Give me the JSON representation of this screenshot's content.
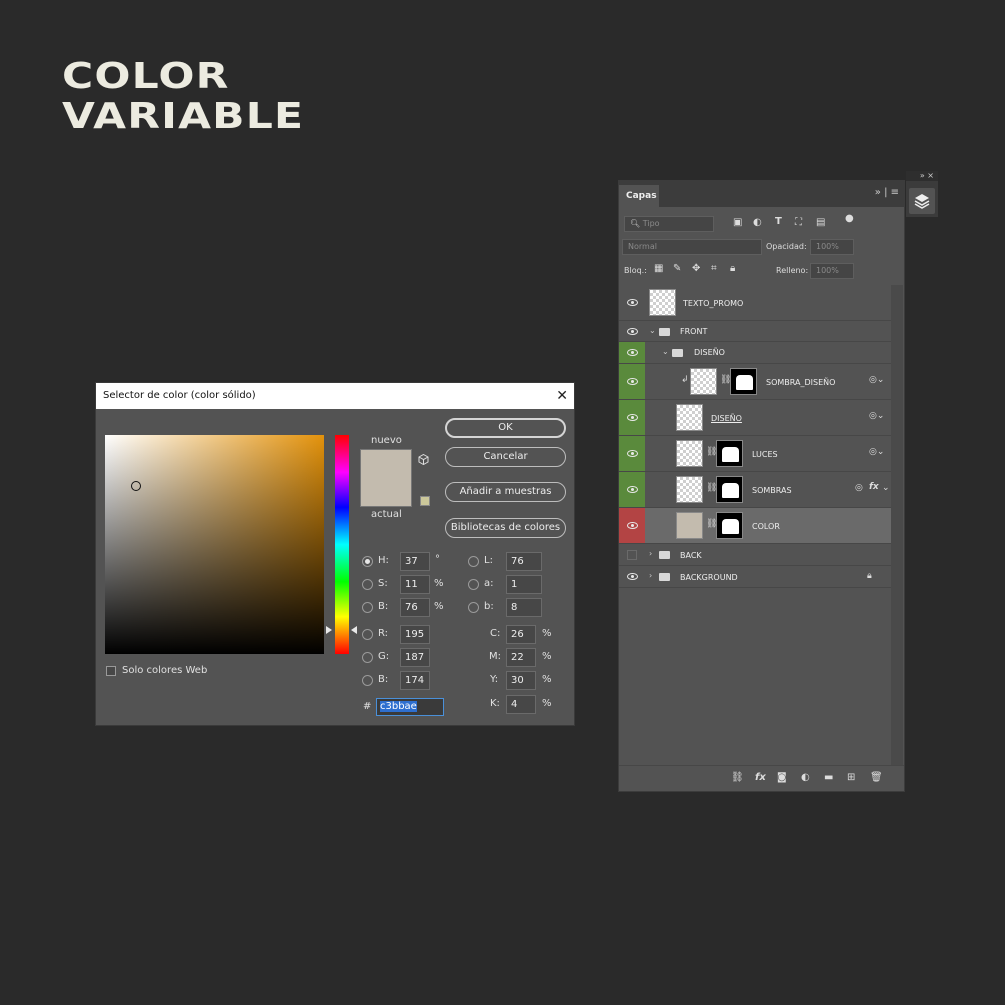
{
  "headline": {
    "line1": "COLOR",
    "line2": "VARIABLE"
  },
  "color_picker": {
    "title": "Selector de color (color sólido)",
    "new_label": "nuevo",
    "current_label": "actual",
    "buttons": {
      "ok": "OK",
      "cancel": "Cancelar",
      "add_swatch": "Añadir a muestras",
      "libraries": "Bibliotecas de colores"
    },
    "web_only_label": "Solo colores Web",
    "hsb": {
      "h_label": "H:",
      "h": "37",
      "h_unit": "°",
      "s_label": "S:",
      "s": "11",
      "s_unit": "%",
      "b_label": "B:",
      "b": "76",
      "b_unit": "%"
    },
    "lab": {
      "l_label": "L:",
      "l": "76",
      "a_label": "a:",
      "a": "1",
      "b_label": "b:",
      "b": "8"
    },
    "rgb": {
      "r_label": "R:",
      "r": "195",
      "g_label": "G:",
      "g": "187",
      "b_label": "B:",
      "b": "174"
    },
    "cmyk": {
      "c_label": "C:",
      "c": "26",
      "m_label": "M:",
      "m": "22",
      "y_label": "Y:",
      "y": "30",
      "k_label": "K:",
      "k": "4",
      "unit": "%"
    },
    "hex_label": "#",
    "hex": "c3bbae",
    "selected_mode": "H",
    "colors": {
      "new": "#c3bbae",
      "current": "#c3bbae",
      "hue": "#e3920b"
    }
  },
  "layers_panel": {
    "tab": "Capas",
    "filter_placeholder": "Tipo",
    "blend_mode": "Normal",
    "opacity_label": "Opacidad:",
    "opacity": "100%",
    "lock_label": "Bloq.:",
    "fill_label": "Relleno:",
    "fill": "100%",
    "layers": [
      {
        "name": "TEXTO_PROMO",
        "type": "smart",
        "visible": true
      },
      {
        "name": "FRONT",
        "type": "group",
        "visible": true
      },
      {
        "name": "DISEÑO",
        "type": "group",
        "visible": true,
        "color": "green"
      },
      {
        "name": "SOMBRA_DISEÑO",
        "type": "smart-mask",
        "visible": true,
        "color": "green"
      },
      {
        "name": "DISEÑO",
        "type": "smart",
        "visible": true,
        "color": "green"
      },
      {
        "name": "LUCES",
        "type": "smart-mask",
        "visible": true,
        "color": "green"
      },
      {
        "name": "SOMBRAS",
        "type": "smart-mask",
        "visible": true,
        "color": "green",
        "fx": "fx"
      },
      {
        "name": "COLOR",
        "type": "fill-mask",
        "visible": true,
        "color": "red",
        "selected": true
      },
      {
        "name": "BACK",
        "type": "group",
        "visible": false
      },
      {
        "name": "BACKGROUND",
        "type": "group",
        "visible": true,
        "locked": true
      }
    ],
    "footer_icons": [
      "link-icon",
      "fx-icon",
      "mask-icon",
      "adjustment-icon",
      "folder-icon",
      "new-layer-icon",
      "trash-icon"
    ]
  }
}
